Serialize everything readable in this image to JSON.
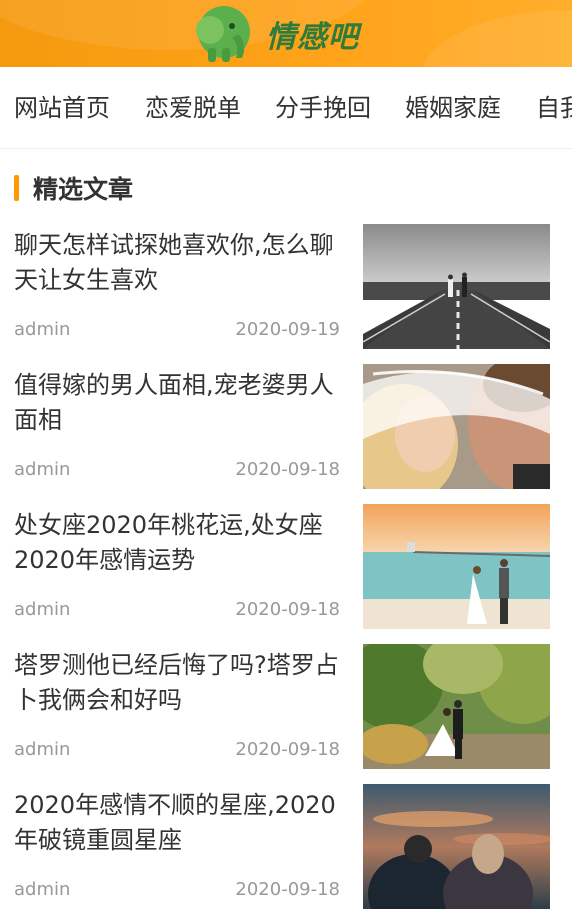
{
  "site": {
    "logo_text": "情感吧"
  },
  "nav": {
    "items": [
      {
        "label": "网站首页"
      },
      {
        "label": "恋爱脱单"
      },
      {
        "label": "分手挽回"
      },
      {
        "label": "婚姻家庭"
      },
      {
        "label": "自我"
      }
    ]
  },
  "section": {
    "title": "精选文章"
  },
  "articles": [
    {
      "title": "聊天怎样试探她喜欢你,怎么聊天让女生喜欢",
      "author": "admin",
      "date": "2020-09-19",
      "image": "couple-on-road-photo"
    },
    {
      "title": "值得嫁的男人面相,宠老婆男人面相",
      "author": "admin",
      "date": "2020-09-18",
      "image": "bride-veil-kiss-photo"
    },
    {
      "title": "处女座2020年桃花运,处女座2020年感情运势",
      "author": "admin",
      "date": "2020-09-18",
      "image": "beach-wedding-photo"
    },
    {
      "title": "塔罗测他已经后悔了吗?塔罗占卜我俩会和好吗",
      "author": "admin",
      "date": "2020-09-18",
      "image": "forest-wedding-photo"
    },
    {
      "title": "2020年感情不顺的星座,2020年破镜重圆星座",
      "author": "admin",
      "date": "2020-09-18",
      "image": "sunset-couple-photo"
    }
  ],
  "colors": {
    "header": "#ffa31a",
    "accent": "#ff9900",
    "logo_green": "#2f7b3b"
  }
}
